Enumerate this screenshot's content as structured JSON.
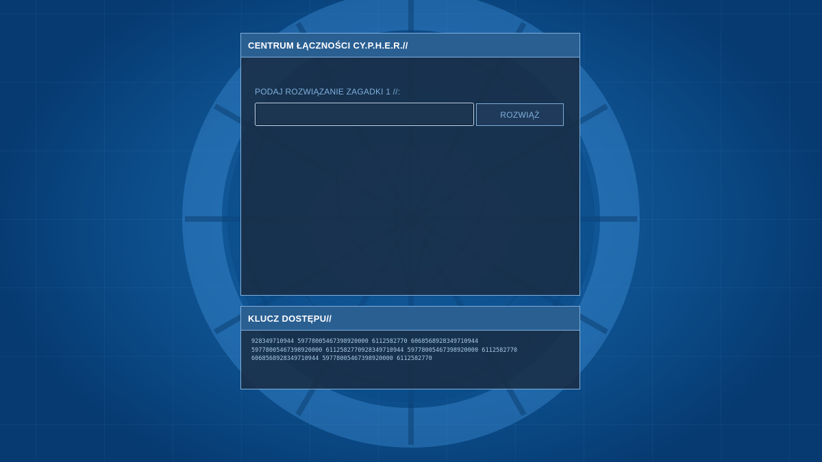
{
  "colors": {
    "background": "#0b4a86",
    "panel_header": "#2a5f92",
    "panel_border": "#7fb0dc",
    "panel_body": "#192d46",
    "accent_text": "#7fb0dc"
  },
  "main_panel": {
    "title": "CENTRUM ŁĄCZNOŚCI CY.P.H.E.R.//",
    "prompt": "PODAJ ROZWIĄZANIE ZAGADKI 1 //:",
    "answer_value": "",
    "answer_placeholder": "",
    "solve_label": "ROZWIĄŻ"
  },
  "key_panel": {
    "title": "KLUCZ DOSTĘPU//",
    "key_lines": [
      "928349710944 59778005467398920000 6112582770 6068568928349710944",
      "59778005467398920000 6112582770928349710944 59778005467398920000 6112582770",
      "6068568928349710944 59778005467398920000 6112582770"
    ]
  },
  "icons": {
    "background_emblem": "circular-rune-emblem-icon"
  }
}
